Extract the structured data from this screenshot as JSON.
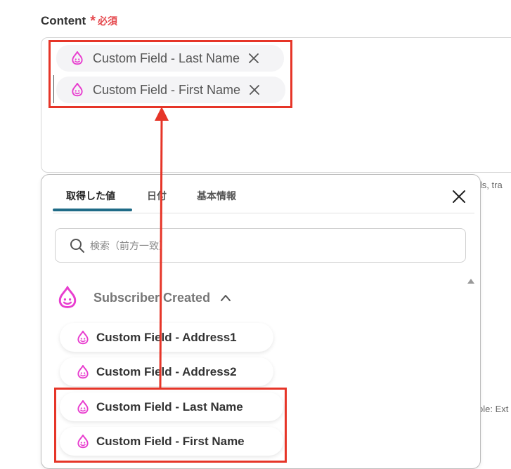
{
  "field": {
    "label": "Content",
    "required_star": "*",
    "required_text": "必須"
  },
  "content_chips": [
    {
      "label": "Custom Field - Last Name",
      "icon": "convertkit-drop-icon",
      "remove_icon": "close-icon"
    },
    {
      "label": "Custom Field - First Name",
      "icon": "convertkit-drop-icon",
      "remove_icon": "close-icon"
    }
  ],
  "background_hints": {
    "right_top": "ils, tra",
    "right_bottom": "ole: Ext"
  },
  "picker": {
    "tabs": [
      {
        "label": "取得した値",
        "active": true
      },
      {
        "label": "日付",
        "active": false
      },
      {
        "label": "基本情報",
        "active": false
      }
    ],
    "close_icon": "close-icon",
    "search_placeholder": "検索（前方一致）",
    "section": {
      "title": "Subscriber Created",
      "icon": "convertkit-drop-icon",
      "expanded": true,
      "chevron_icon": "chevron-up-icon"
    },
    "items": [
      {
        "label": "Custom Field - Address1"
      },
      {
        "label": "Custom Field - Address2"
      },
      {
        "label": "Custom Field - Last Name"
      },
      {
        "label": "Custom Field - First Name"
      }
    ]
  },
  "colors": {
    "highlight": "#e63528",
    "brand_icon": "#e83ecf",
    "tab_active": "#1f6b87",
    "required": "#e5484d"
  }
}
